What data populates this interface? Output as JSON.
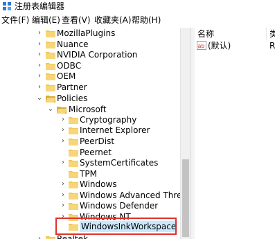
{
  "window": {
    "title": "注册表编辑器",
    "icon": "registry-editor-icon"
  },
  "menu": [
    "文件(F)",
    "编辑(E)",
    "查看(V)",
    "收藏夹(A)",
    "帮助(H)"
  ],
  "tree": {
    "items": [
      {
        "label": "MozillaPlugins",
        "expander": "chevron-right-icon"
      },
      {
        "label": "Nuance",
        "expander": "chevron-right-icon"
      },
      {
        "label": "NVIDIA Corporation",
        "expander": "chevron-right-icon"
      },
      {
        "label": "ODBC",
        "expander": "chevron-right-icon"
      },
      {
        "label": "OEM",
        "expander": "chevron-right-icon"
      },
      {
        "label": "Partner",
        "expander": "chevron-right-icon"
      },
      {
        "label": "Policies",
        "expander": "chevron-down-icon"
      },
      {
        "label": "Microsoft",
        "expander": "chevron-down-icon"
      },
      {
        "label": "Cryptography",
        "expander": "chevron-right-icon"
      },
      {
        "label": "Internet Explorer",
        "expander": "chevron-right-icon"
      },
      {
        "label": "PeerDist",
        "expander": "chevron-right-icon"
      },
      {
        "label": "Peernet",
        "expander": "none"
      },
      {
        "label": "SystemCertificates",
        "expander": "chevron-right-icon"
      },
      {
        "label": "TPM",
        "expander": "none"
      },
      {
        "label": "Windows",
        "expander": "chevron-right-icon"
      },
      {
        "label": "Windows Advanced Threat P",
        "expander": "chevron-right-icon"
      },
      {
        "label": "Windows Defender",
        "expander": "chevron-right-icon"
      },
      {
        "label": "Windows NT",
        "expander": "chevron-right-icon"
      },
      {
        "label": "WindowsInkWorkspace",
        "expander": "none",
        "selected": true
      },
      {
        "label": "Realtek",
        "expander": "chevron-right-icon"
      }
    ]
  },
  "values_panel": {
    "columns": [
      "名称",
      "类"
    ],
    "rows": [
      {
        "name": "(默认)",
        "type": "R",
        "icon": "string-value-icon"
      }
    ]
  },
  "colors": {
    "folder": "#f1c75b",
    "folder_dark": "#d9a93a",
    "highlight": "#e0312a",
    "selected": "#cce8ff"
  }
}
